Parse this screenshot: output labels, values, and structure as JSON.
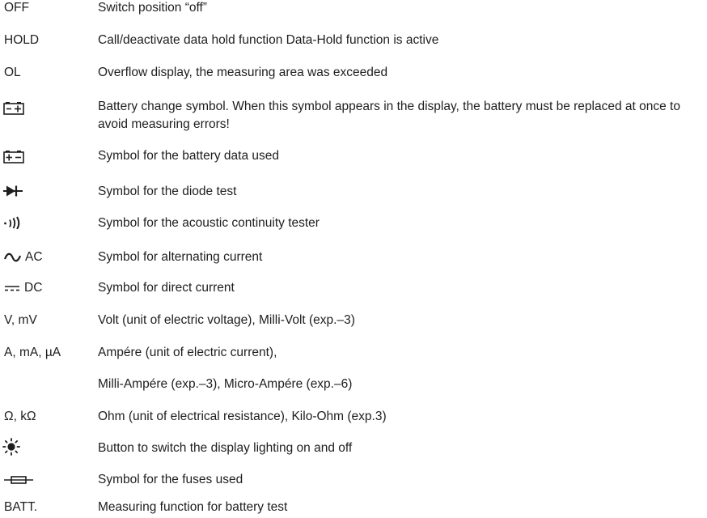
{
  "entries": [
    {
      "term": "OFF",
      "desc": "Switch position “off”"
    },
    {
      "term": "HOLD",
      "desc": "Call/deactivate data hold function Data-Hold function is active"
    },
    {
      "term": "OL",
      "desc": "Overflow display, the measuring area was exceeded"
    },
    {
      "icon": "battery-change-icon",
      "desc": "Battery change symbol. When this symbol appears in the display, the battery must be replaced at once to avoid measuring errors!"
    },
    {
      "icon": "battery-data-icon",
      "desc": "Symbol for the battery data used"
    },
    {
      "icon": "diode-icon",
      "desc": "Symbol for the diode test"
    },
    {
      "icon": "continuity-tester-icon",
      "desc": "Symbol for the acoustic continuity tester"
    },
    {
      "icon": "alternating-current-icon",
      "term": "AC",
      "desc": "Symbol for alternating current"
    },
    {
      "icon": "direct-current-icon",
      "term": "DC",
      "desc": "Symbol for direct current"
    },
    {
      "term": "V, mV",
      "desc": "Volt (unit of electric voltage), Milli-Volt (exp.–3)"
    },
    {
      "term": "A, mA, µA",
      "desc": "Ampére (unit of electric current),"
    },
    {
      "term": "",
      "desc": "Milli-Ampére (exp.–3), Micro-Ampére (exp.–6)"
    },
    {
      "term": "Ω, kΩ",
      "desc": "Ohm (unit of electrical resistance), Kilo-Ohm (exp.3)"
    },
    {
      "icon": "display-light-icon",
      "desc": "Button to switch the display lighting on and off"
    },
    {
      "icon": "fuse-icon",
      "desc": "Symbol for the fuses used"
    },
    {
      "term": "BATT.",
      "desc": "Measuring function for battery test"
    }
  ]
}
